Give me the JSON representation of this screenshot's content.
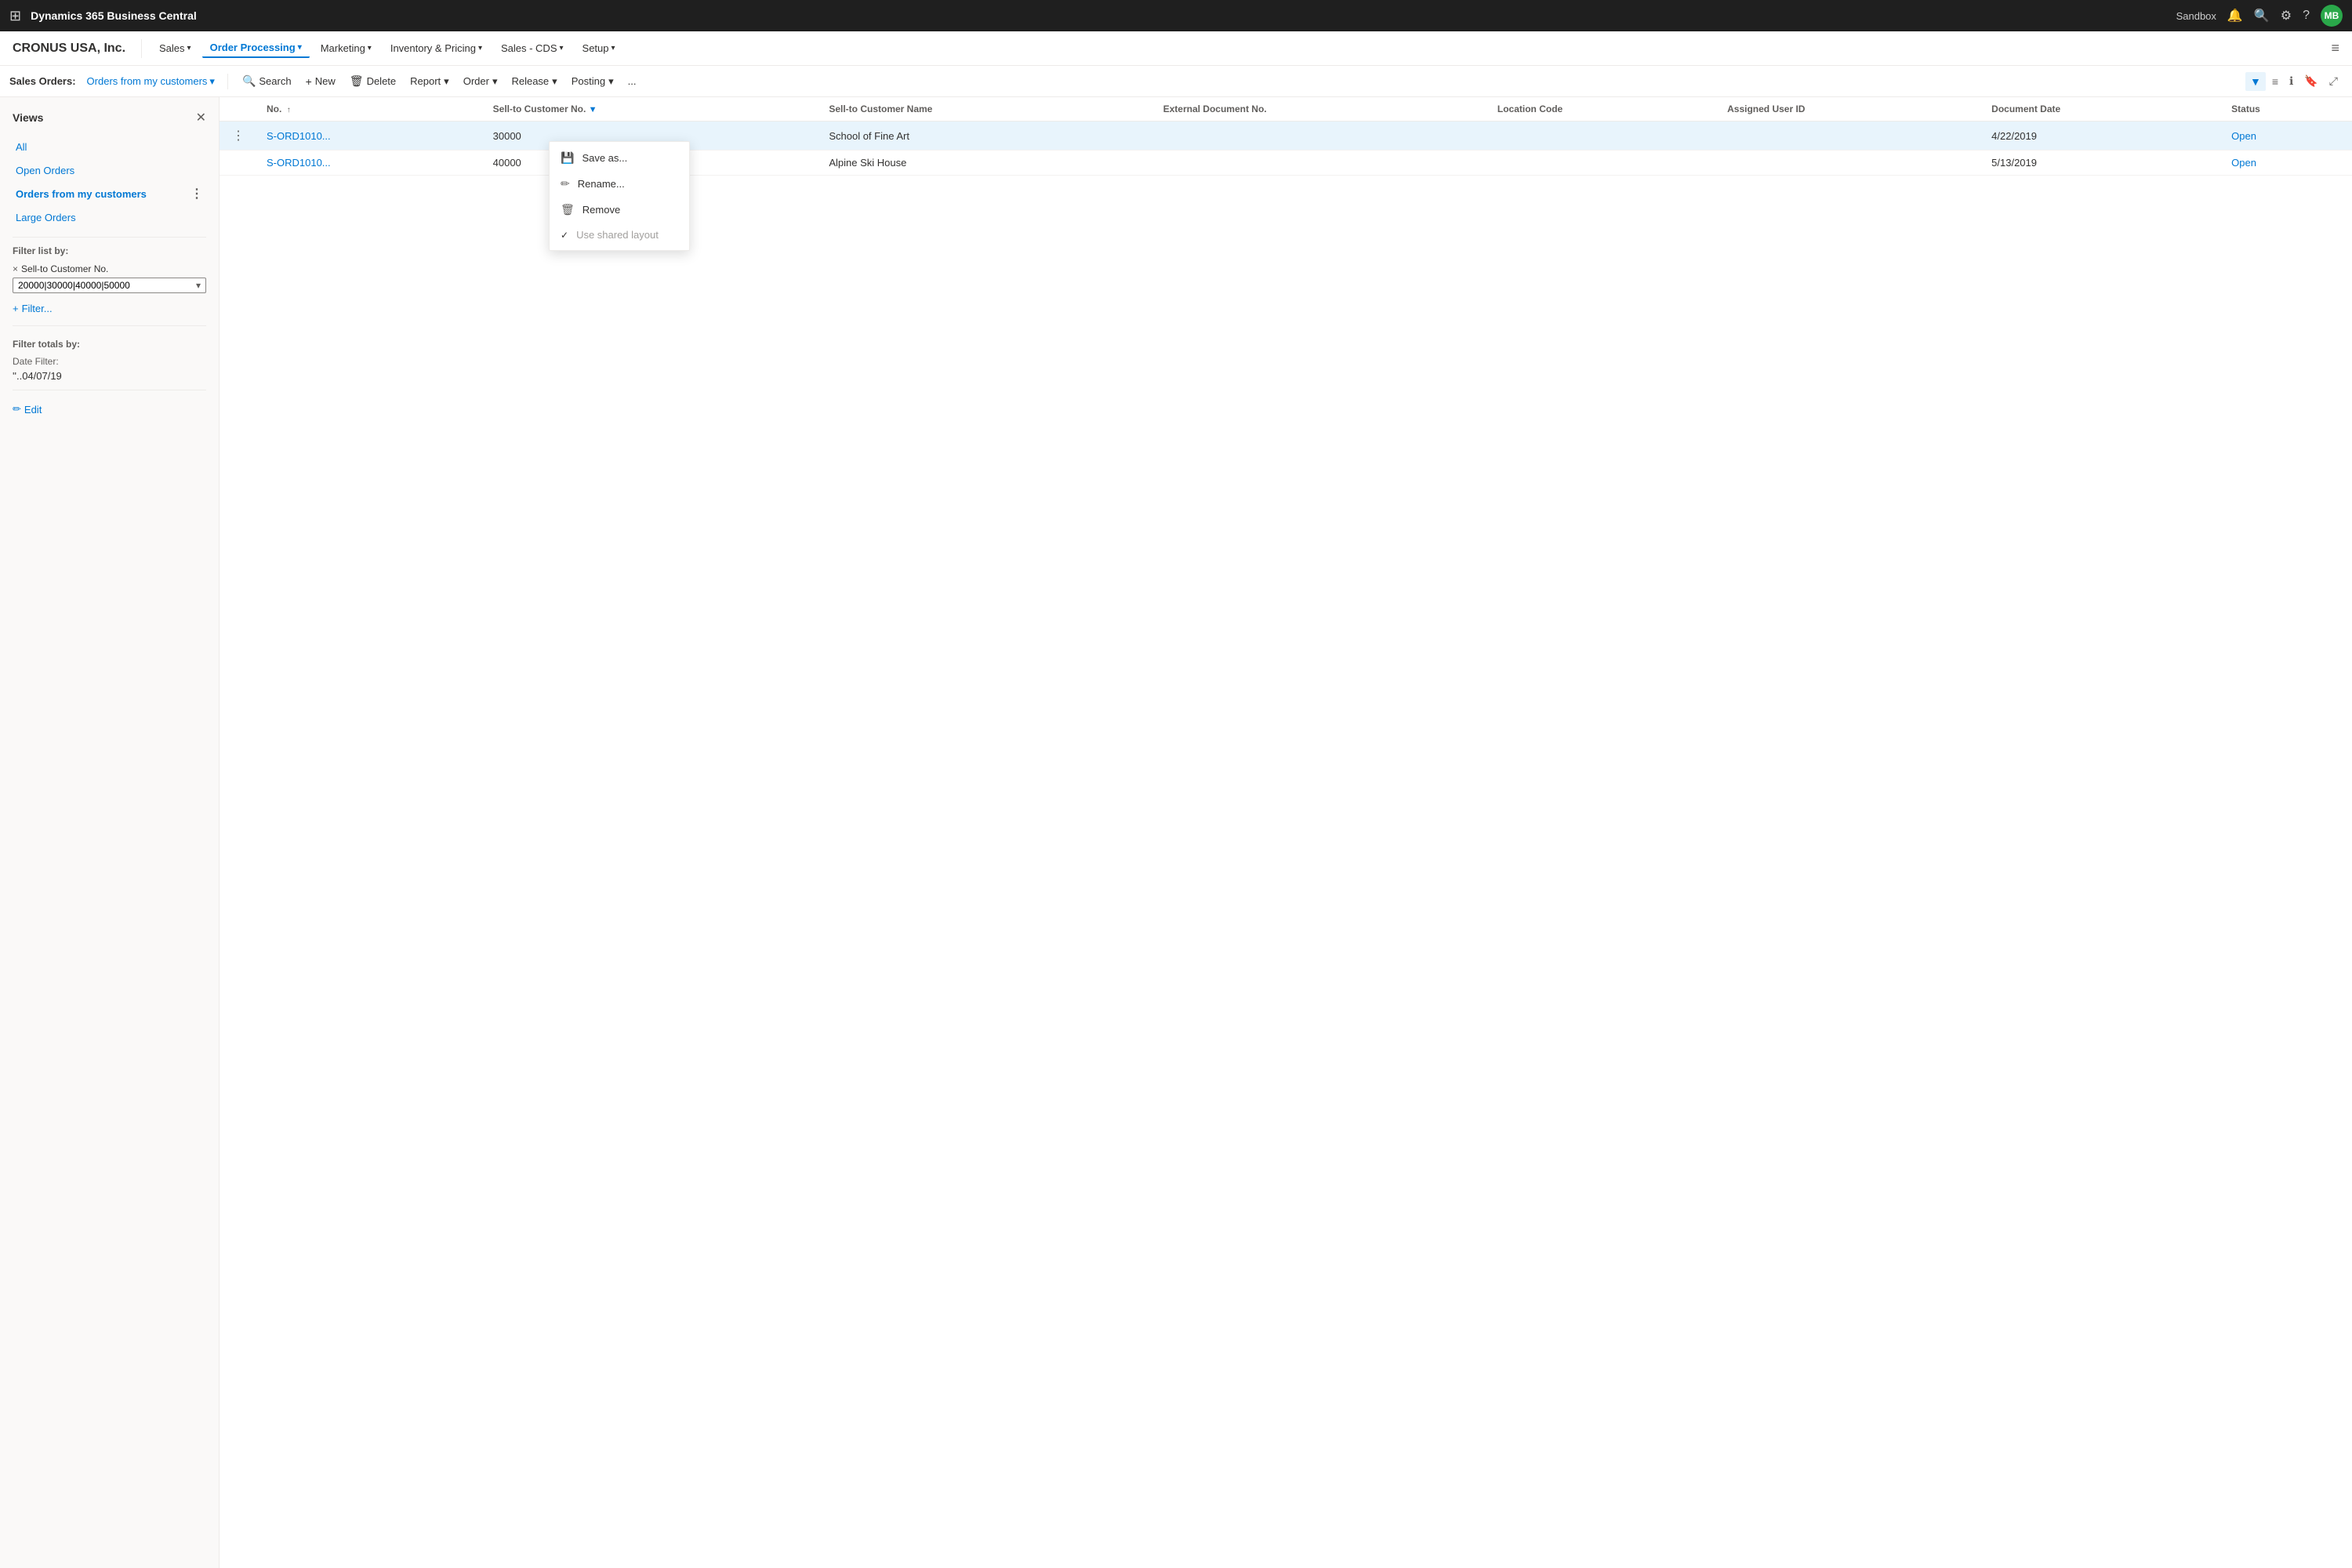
{
  "app": {
    "title": "Dynamics 365 Business Central",
    "environment": "Sandbox",
    "user_initials": "MB"
  },
  "secondary_nav": {
    "company": "CRONUS USA, Inc.",
    "items": [
      {
        "label": "Sales",
        "active": false,
        "has_chevron": true
      },
      {
        "label": "Order Processing",
        "active": true,
        "has_chevron": true
      },
      {
        "label": "Marketing",
        "active": false,
        "has_chevron": true
      },
      {
        "label": "Inventory & Pricing",
        "active": false,
        "has_chevron": true
      },
      {
        "label": "Sales - CDS",
        "active": false,
        "has_chevron": true
      },
      {
        "label": "Setup",
        "active": false,
        "has_chevron": true
      }
    ]
  },
  "toolbar": {
    "label": "Sales Orders:",
    "view_name": "Orders from my customers",
    "buttons": [
      {
        "id": "search",
        "label": "Search",
        "icon": "🔍"
      },
      {
        "id": "new",
        "label": "New",
        "icon": "+"
      },
      {
        "id": "delete",
        "label": "Delete",
        "icon": "🗑"
      },
      {
        "id": "report",
        "label": "Report",
        "icon": "📄",
        "has_chevron": true
      },
      {
        "id": "order",
        "label": "Order",
        "icon": "",
        "has_chevron": true
      },
      {
        "id": "release",
        "label": "Release",
        "icon": "",
        "has_chevron": true
      },
      {
        "id": "posting",
        "label": "Posting",
        "icon": "",
        "has_chevron": true
      },
      {
        "id": "more",
        "label": "...",
        "icon": ""
      }
    ]
  },
  "views": {
    "title": "Views",
    "items": [
      {
        "label": "All",
        "active": false
      },
      {
        "label": "Open Orders",
        "active": false
      },
      {
        "label": "Orders from my customers",
        "active": true
      },
      {
        "label": "Large Orders",
        "active": false
      }
    ]
  },
  "filter_list": {
    "label": "Filter list by:",
    "chips": [
      {
        "field": "Sell-to Customer No.",
        "remove": "×"
      }
    ],
    "input_value": "20000|30000|40000|50000",
    "add_filter_label": "+ Filter..."
  },
  "filter_totals": {
    "label": "Filter totals by:",
    "date_label": "Date Filter:",
    "date_value": "''..04/07/19"
  },
  "edit_label": "Edit",
  "table": {
    "columns": [
      {
        "id": "no",
        "label": "No.",
        "sort": "↑",
        "filter": false
      },
      {
        "id": "sell_to_customer_no",
        "label": "Sell-to Customer No.",
        "sort": "",
        "filter": true
      },
      {
        "id": "sell_to_customer_name",
        "label": "Sell-to Customer Name",
        "sort": "",
        "filter": false
      },
      {
        "id": "external_doc_no",
        "label": "External Document No.",
        "sort": "",
        "filter": false
      },
      {
        "id": "location_code",
        "label": "Location Code",
        "sort": "",
        "filter": false
      },
      {
        "id": "assigned_user_id",
        "label": "Assigned User ID",
        "sort": "",
        "filter": false
      },
      {
        "id": "document_date",
        "label": "Document Date",
        "sort": "",
        "filter": false
      },
      {
        "id": "status",
        "label": "Status",
        "sort": "",
        "filter": false
      }
    ],
    "rows": [
      {
        "no": "S-ORD1010...",
        "sell_to_customer_no": "30000",
        "sell_to_customer_name": "School of Fine Art",
        "external_doc_no": "",
        "location_code": "",
        "assigned_user_id": "",
        "document_date": "4/22/2019",
        "status": "Open",
        "selected": true
      },
      {
        "no": "S-ORD1010...",
        "sell_to_customer_no": "40000",
        "sell_to_customer_name": "Alpine Ski House",
        "external_doc_no": "",
        "location_code": "",
        "assigned_user_id": "",
        "document_date": "5/13/2019",
        "status": "Open",
        "selected": false
      }
    ]
  },
  "context_menu": {
    "visible": true,
    "items": [
      {
        "id": "save-as",
        "label": "Save as...",
        "icon": "💾",
        "disabled": false
      },
      {
        "id": "rename",
        "label": "Rename...",
        "icon": "✏️",
        "disabled": false
      },
      {
        "id": "remove",
        "label": "Remove",
        "icon": "🗑",
        "disabled": false
      },
      {
        "id": "shared-layout",
        "label": "Use shared layout",
        "icon": "✓",
        "disabled": true,
        "checked": true
      }
    ]
  }
}
